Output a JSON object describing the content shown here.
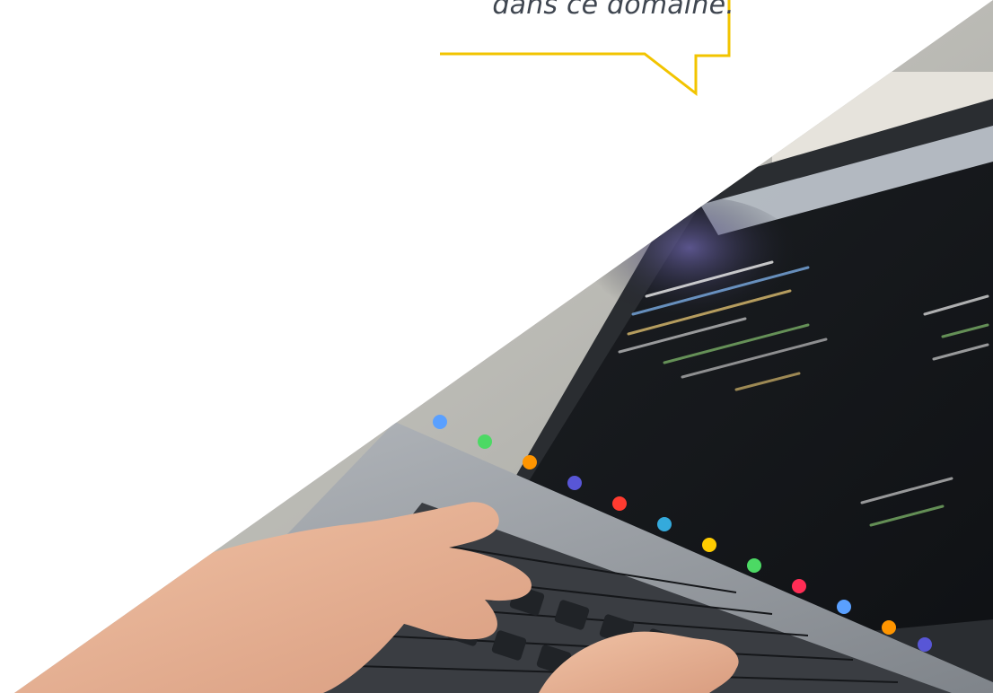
{
  "quote": {
    "text_line": "dans ce domaine."
  },
  "photo": {
    "subject": "laptop-with-code-and-typing-hands"
  },
  "colors": {
    "bubble_outline": "#f2c400",
    "quote_text": "#3f4650",
    "background": "#ffffff",
    "screen": "#16191d",
    "laptop_body": "#8f9499",
    "keys": "#202327",
    "skin": "#e7b092"
  }
}
